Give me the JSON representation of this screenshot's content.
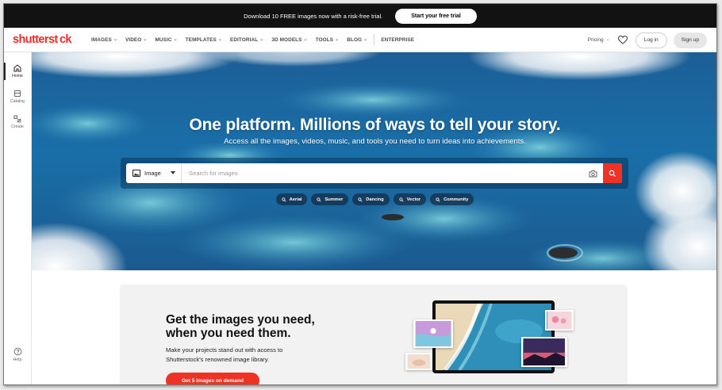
{
  "promo_bar": {
    "text": "Download 10 FREE images now with a risk-free trial.",
    "button": "Start your free trial"
  },
  "header": {
    "logo": "shutterst ck",
    "nav": [
      {
        "label": "IMAGES",
        "dropdown": true
      },
      {
        "label": "VIDEO",
        "dropdown": true
      },
      {
        "label": "MUSIC",
        "dropdown": true
      },
      {
        "label": "TEMPLATES",
        "dropdown": true
      },
      {
        "label": "EDITORIAL",
        "dropdown": true
      },
      {
        "label": "3D MODELS",
        "dropdown": true
      },
      {
        "label": "TOOLS",
        "dropdown": true
      },
      {
        "label": "BLOG",
        "dropdown": true
      },
      {
        "label": "ENTERPRISE",
        "dropdown": false
      }
    ],
    "pricing": "Pricing",
    "login": "Log in",
    "signup": "Sign up"
  },
  "sidebar": {
    "items": [
      {
        "label": "Home",
        "icon": "home-icon",
        "active": true
      },
      {
        "label": "Catalog",
        "icon": "catalog-icon",
        "active": false
      },
      {
        "label": "Create",
        "icon": "create-icon",
        "active": false
      }
    ],
    "help": "Help"
  },
  "hero": {
    "title": "One platform. Millions of ways to tell your story.",
    "subtitle": "Access all the images, videos, music, and tools you need to turn ideas into achievements.",
    "search": {
      "type": "Image",
      "placeholder": "Search for images"
    },
    "chips": [
      "Aerial",
      "Summer",
      "Dancing",
      "Vector",
      "Community"
    ]
  },
  "card": {
    "title_line1": "Get the images you need,",
    "title_line2": "when you need them.",
    "body": "Make your projects stand out with access to Shutterstock's renowned image library.",
    "cta": "Get 5 images on demand"
  },
  "colors": {
    "brand_red": "#ee2b24",
    "promo_bg": "#121212",
    "search_button": "#ee3224"
  }
}
